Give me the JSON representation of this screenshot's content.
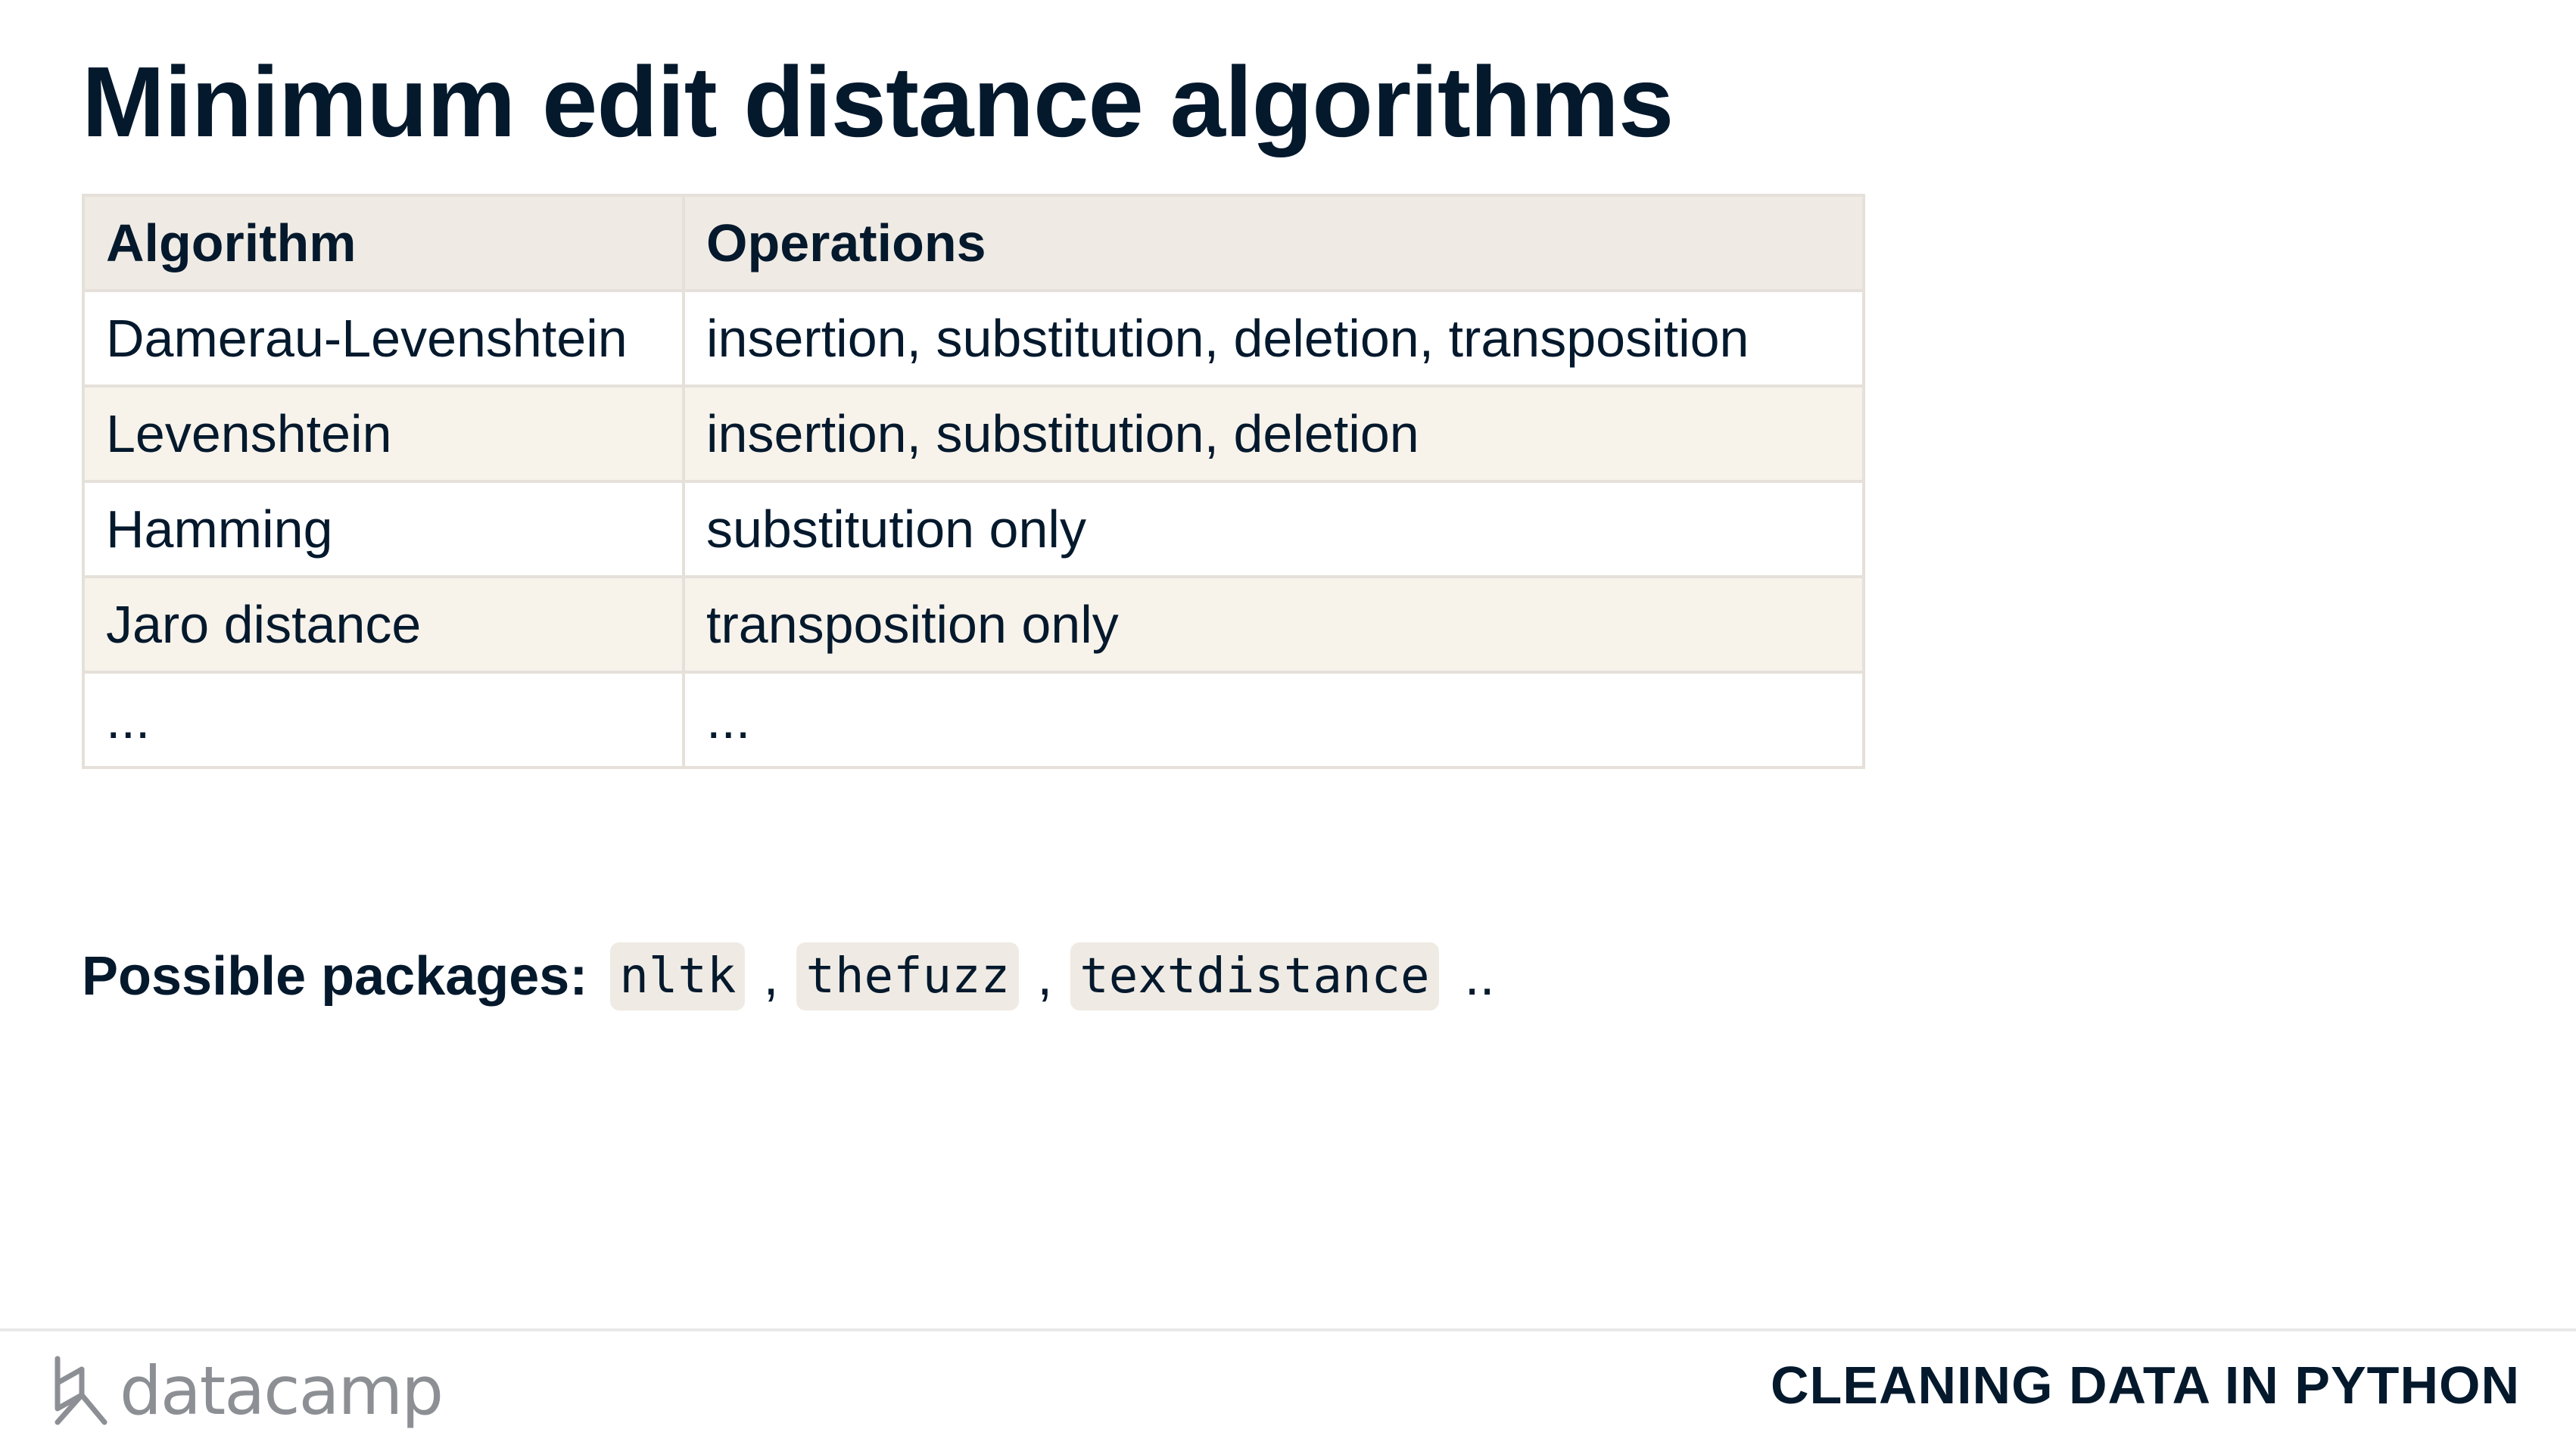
{
  "slide": {
    "title": "Minimum edit distance algorithms"
  },
  "table": {
    "headers": [
      "Algorithm",
      "Operations"
    ],
    "rows": [
      [
        "Damerau-Levenshtein",
        "insertion, substitution, deletion, transposition"
      ],
      [
        "Levenshtein",
        "insertion, substitution, deletion"
      ],
      [
        "Hamming",
        "substitution only"
      ],
      [
        "Jaro distance",
        "transposition only"
      ],
      [
        "...",
        "..."
      ]
    ]
  },
  "packages": {
    "label": "Possible packages:",
    "items": [
      "nltk",
      "thefuzz",
      "textdistance"
    ],
    "separator": ",",
    "trailing": ".."
  },
  "footer": {
    "logo_text": "datacamp",
    "logo_icon": "datacamp-logo-icon",
    "course": "CLEANING DATA IN PYTHON"
  }
}
